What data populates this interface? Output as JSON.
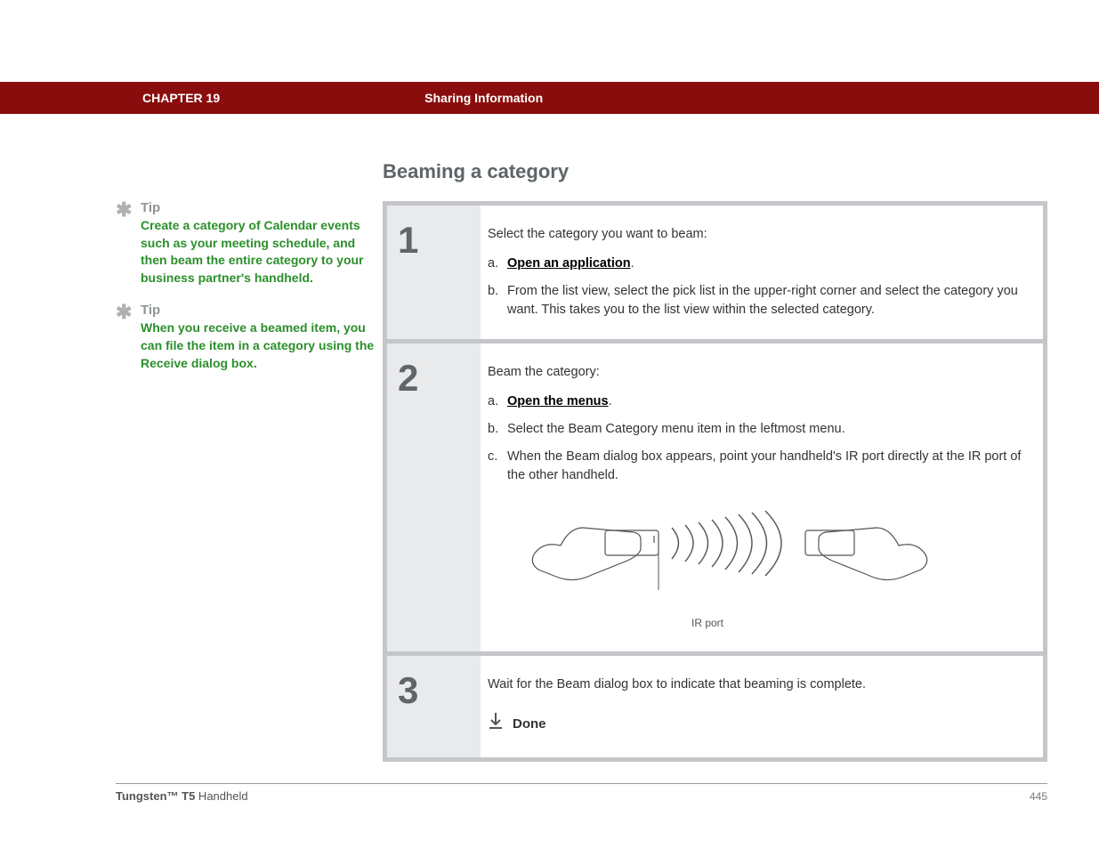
{
  "header": {
    "chapter": "CHAPTER 19",
    "section": "Sharing Information"
  },
  "sidebar": {
    "tips": [
      {
        "label": "Tip",
        "text": "Create a category of Calendar events such as your meeting schedule, and then beam the entire category to your business partner's handheld."
      },
      {
        "label": "Tip",
        "text": "When you receive a beamed item, you can file the item in a category using the Receive dialog box."
      }
    ]
  },
  "main": {
    "title": "Beaming a category",
    "steps": [
      {
        "num": "1",
        "intro": "Select the category you want to beam:",
        "items": [
          {
            "letter": "a.",
            "link": "Open an application",
            "after": "."
          },
          {
            "letter": "b.",
            "text": "From the list view, select the pick list in the upper-right corner and select the category you want. This takes you to the list view within the selected category."
          }
        ]
      },
      {
        "num": "2",
        "intro": "Beam the category:",
        "items": [
          {
            "letter": "a.",
            "link": "Open the menus",
            "after": "."
          },
          {
            "letter": "b.",
            "text": "Select the Beam Category menu item in the leftmost menu."
          },
          {
            "letter": "c.",
            "text": "When the Beam dialog box appears, point your handheld's IR port directly at the IR port of the other handheld."
          }
        ],
        "ir_caption": "IR port"
      },
      {
        "num": "3",
        "intro": "Wait for the Beam dialog box to indicate that beaming is complete.",
        "done_label": "Done"
      }
    ]
  },
  "footer": {
    "product_bold": "Tungsten™ T5",
    "product_rest": " Handheld",
    "page_number": "445"
  }
}
